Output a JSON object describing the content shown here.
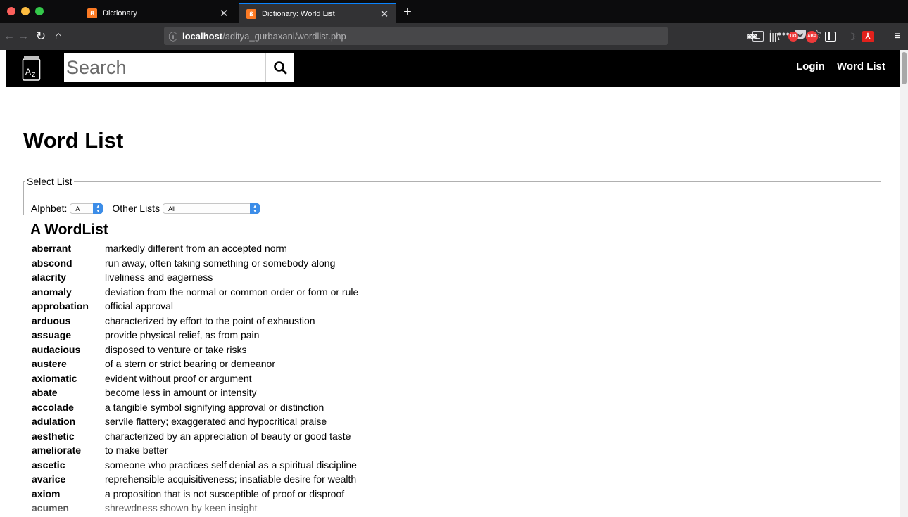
{
  "browser": {
    "tabs": [
      {
        "title": "Dictionary",
        "favicon": "xampp-icon",
        "active": false
      },
      {
        "title": "Dictionary: World List",
        "favicon": "xampp-icon",
        "active": true
      }
    ],
    "close_glyph": "✕",
    "new_tab_glyph": "+",
    "url_host": "localhost",
    "url_path": "/aditya_gurbaxani/wordlist.php",
    "url_more_glyph": "•••",
    "toolbar_icons": [
      "back-icon",
      "forward-icon",
      "reload-icon",
      "home-icon",
      "info-icon",
      "reader-mode-icon",
      "page-actions-icon",
      "pocket-icon",
      "bookmark-star-icon",
      "reading-glasses-icon",
      "library-icon",
      "ublock-icon",
      "adblock-plus-icon",
      "sidebar-icon",
      "extension-icon",
      "pdf-icon",
      "hamburger-menu-icon"
    ],
    "ublock_text": "UO",
    "abp_text": "ABP",
    "accent": "#0a84ff"
  },
  "header": {
    "logo_text": "Az",
    "search_placeholder": "Search",
    "nav": {
      "login": "Login",
      "word_list": "Word List"
    },
    "background": "#000000"
  },
  "main": {
    "title": "Word List",
    "filter": {
      "legend": "Select List",
      "alphabet_label": "Alphbet:",
      "alphabet_value": "A",
      "other_label": "Other Lists",
      "other_value": "All"
    },
    "list_heading": "A WordList",
    "words": [
      {
        "term": "aberrant",
        "definition": "markedly different from an accepted norm"
      },
      {
        "term": "abscond",
        "definition": "run away, often taking something or somebody along"
      },
      {
        "term": "alacrity",
        "definition": "liveliness and eagerness"
      },
      {
        "term": "anomaly",
        "definition": "deviation from the normal or common order or form or rule"
      },
      {
        "term": "approbation",
        "definition": "official approval"
      },
      {
        "term": "arduous",
        "definition": "characterized by effort to the point of exhaustion"
      },
      {
        "term": "assuage",
        "definition": "provide physical relief, as from pain"
      },
      {
        "term": "audacious",
        "definition": "disposed to venture or take risks"
      },
      {
        "term": "austere",
        "definition": "of a stern or strict bearing or demeanor"
      },
      {
        "term": "axiomatic",
        "definition": "evident without proof or argument"
      },
      {
        "term": "abate",
        "definition": "become less in amount or intensity"
      },
      {
        "term": "accolade",
        "definition": "a tangible symbol signifying approval or distinction"
      },
      {
        "term": "adulation",
        "definition": "servile flattery; exaggerated and hypocritical praise"
      },
      {
        "term": "aesthetic",
        "definition": "characterized by an appreciation of beauty or good taste"
      },
      {
        "term": "ameliorate",
        "definition": "to make better"
      },
      {
        "term": "ascetic",
        "definition": "someone who practices self denial as a spiritual discipline"
      },
      {
        "term": "avarice",
        "definition": "reprehensible acquisitiveness; insatiable desire for wealth"
      },
      {
        "term": "axiom",
        "definition": "a proposition that is not susceptible of proof or disproof"
      },
      {
        "term": "acumen",
        "definition": "shrewdness shown by keen insight"
      }
    ]
  }
}
